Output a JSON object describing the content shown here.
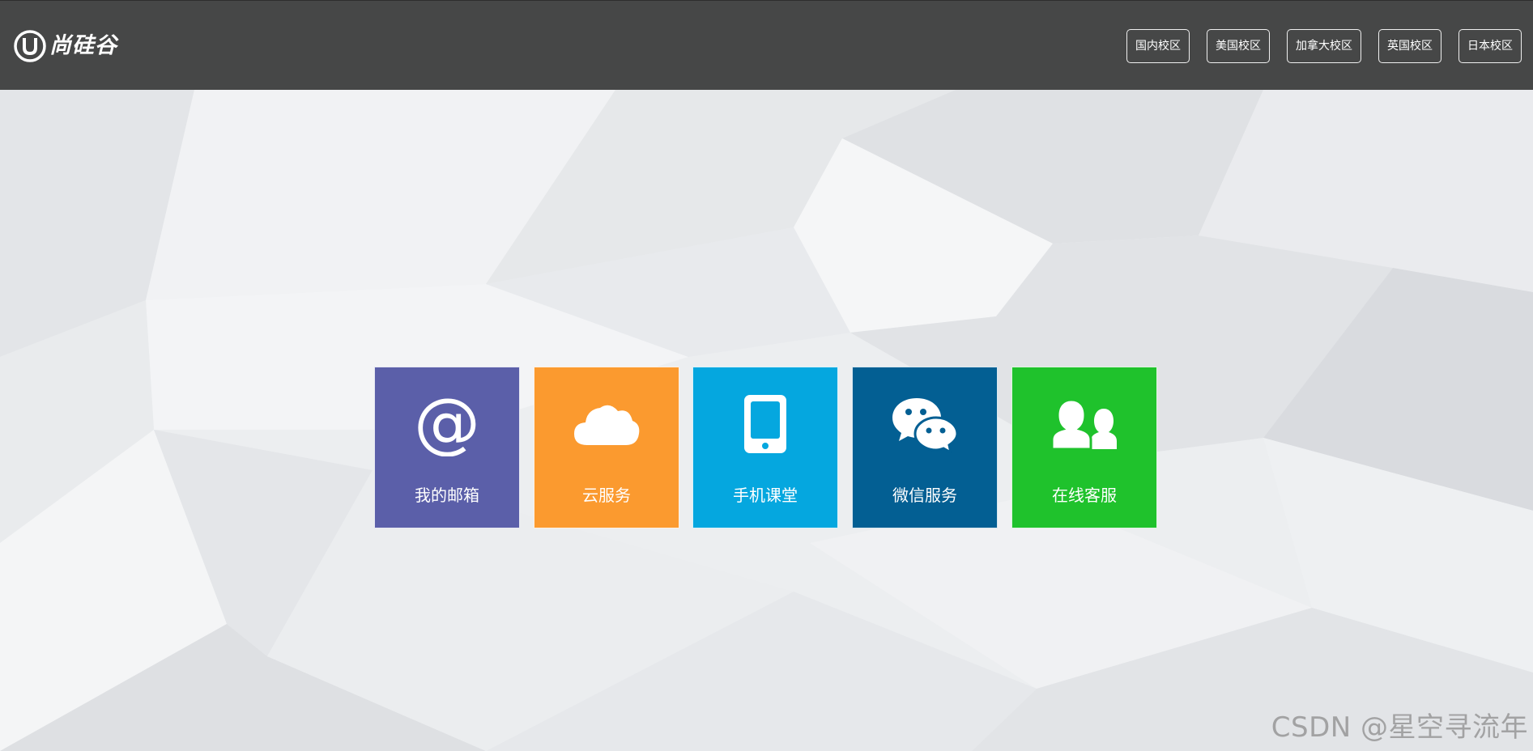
{
  "header": {
    "logo_text": "尚硅谷",
    "campus_nav": [
      "国内校区",
      "美国校区",
      "加拿大校区",
      "英国校区",
      "日本校区"
    ]
  },
  "tiles": [
    {
      "label": "我的邮箱",
      "icon": "at-sign-icon",
      "color": "#5b5fa9"
    },
    {
      "label": "云服务",
      "icon": "cloud-icon",
      "color": "#fb9a2f"
    },
    {
      "label": "手机课堂",
      "icon": "mobile-phone-icon",
      "color": "#05a7df"
    },
    {
      "label": "微信服务",
      "icon": "wechat-icon",
      "color": "#035f93"
    },
    {
      "label": "在线客服",
      "icon": "users-icon",
      "color": "#1fc22c"
    }
  ],
  "watermark": "CSDN @星空寻流年",
  "colors": {
    "header_bg": "#464747",
    "page_bg": "#eceef0"
  }
}
